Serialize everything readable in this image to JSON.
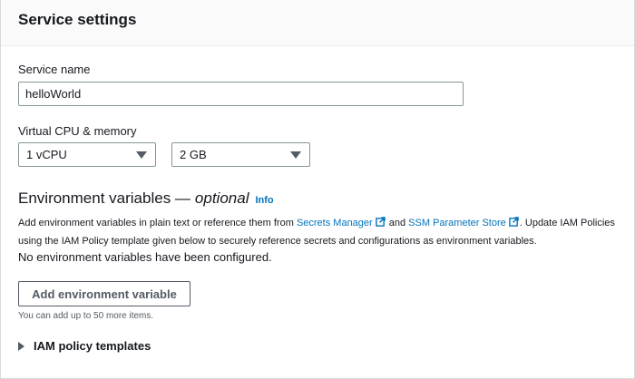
{
  "panel": {
    "title": "Service settings"
  },
  "service_name": {
    "label": "Service name",
    "value": "helloWorld"
  },
  "cpu_memory": {
    "label": "Virtual CPU & memory",
    "cpu_value": "1 vCPU",
    "memory_value": "2 GB"
  },
  "env_vars": {
    "heading": "Environment variables —",
    "heading_optional": "optional",
    "info_label": "Info",
    "desc_part1": "Add environment variables in plain text or reference them from ",
    "secrets_manager_link": "Secrets Manager",
    "desc_part2": " and ",
    "ssm_link": "SSM Parameter Store",
    "desc_part3": ". Update IAM Policies using the IAM Policy template given below to securely reference secrets and configurations as environment variables.",
    "empty_text": "No environment variables have been configured.",
    "add_button_label": "Add environment variable",
    "hint": "You can add up to 50 more items."
  },
  "iam": {
    "expander_label": "IAM policy templates"
  },
  "colors": {
    "link": "#0073bb",
    "text": "#16191f",
    "border": "#879596"
  }
}
